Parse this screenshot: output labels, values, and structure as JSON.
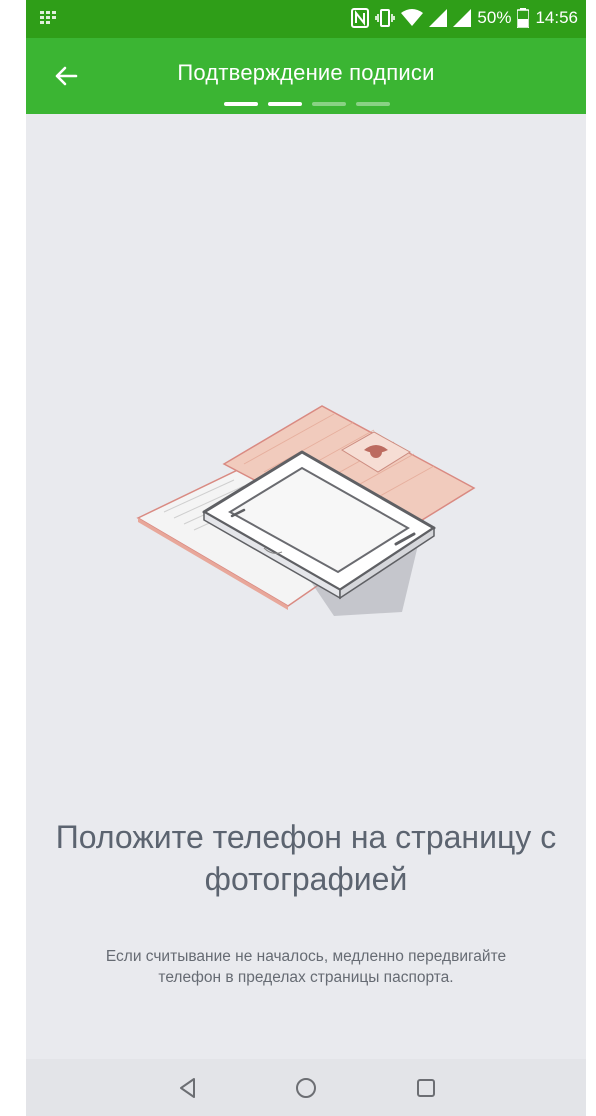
{
  "status_bar": {
    "battery_percent": "50%",
    "time": "14:56",
    "icons": [
      "grid-app-icon",
      "nfc-icon",
      "vibrate-icon",
      "wifi-icon",
      "signal-icon",
      "signal-icon-2",
      "battery-icon"
    ]
  },
  "app_bar": {
    "title": "Подтверждение подписи",
    "back_icon": "arrow-left-icon",
    "progress": {
      "total_steps": 4,
      "active_steps": 2
    }
  },
  "main": {
    "illustration": "phone-on-passport-illustration",
    "headline": "Положите телефон на страницу с фотографией",
    "hint": "Если считывание не началось, медленно передвигайте телефон в пределах страницы паспорта."
  },
  "nav_bar": {
    "buttons": [
      "back-triangle-icon",
      "home-circle-icon",
      "recents-square-icon"
    ]
  },
  "colors": {
    "status_bar": "#2f9e18",
    "app_bar": "#3bb533",
    "background": "#e9eaee",
    "headline": "#5c6470",
    "passport": "#e9b6a3"
  }
}
